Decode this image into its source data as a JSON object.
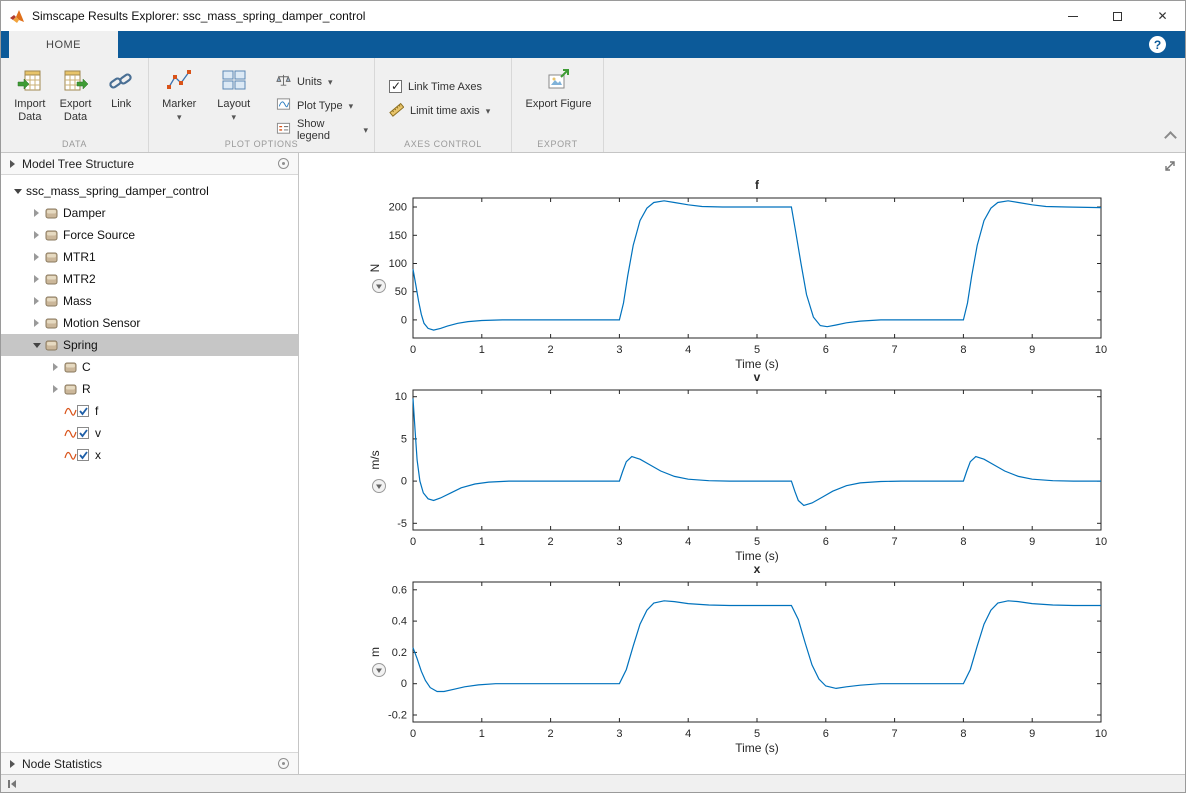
{
  "window": {
    "title": "Simscape Results Explorer: ssc_mass_spring_damper_control"
  },
  "ribbon": {
    "tab": "HOME",
    "sections": {
      "data": {
        "label": "DATA",
        "import": "Import Data",
        "export": "Export Data",
        "link": "Link"
      },
      "plot_options": {
        "label": "PLOT OPTIONS",
        "marker": "Marker",
        "layout": "Layout",
        "units": "Units",
        "plot_type": "Plot Type",
        "show_legend": "Show legend"
      },
      "axes_control": {
        "label": "AXES CONTROL",
        "link_time_axes": "Link Time Axes",
        "link_checked": true,
        "limit_time_axis": "Limit time axis",
        "limit_checked": false
      },
      "export": {
        "label": "EXPORT",
        "export_figure": "Export Figure"
      }
    }
  },
  "left_panel": {
    "tree_header": "Model Tree Structure",
    "stats_header": "Node Statistics",
    "tree": [
      {
        "label": "ssc_mass_spring_damper_control",
        "level": 0,
        "expander": "expanded",
        "icon": "none",
        "selected": false
      },
      {
        "label": "Damper",
        "level": 1,
        "expander": "collapsed",
        "icon": "component",
        "selected": false
      },
      {
        "label": "Force Source",
        "level": 1,
        "expander": "collapsed",
        "icon": "component",
        "selected": false
      },
      {
        "label": "MTR1",
        "level": 1,
        "expander": "collapsed",
        "icon": "component",
        "selected": false
      },
      {
        "label": "MTR2",
        "level": 1,
        "expander": "collapsed",
        "icon": "component",
        "selected": false
      },
      {
        "label": "Mass",
        "level": 1,
        "expander": "collapsed",
        "icon": "component",
        "selected": false
      },
      {
        "label": "Motion Sensor",
        "level": 1,
        "expander": "collapsed",
        "icon": "component",
        "selected": false
      },
      {
        "label": "Spring",
        "level": 1,
        "expander": "expanded",
        "icon": "component",
        "selected": true
      },
      {
        "label": "C",
        "level": 2,
        "expander": "collapsed",
        "icon": "component",
        "selected": false
      },
      {
        "label": "R",
        "level": 2,
        "expander": "collapsed",
        "icon": "component",
        "selected": false
      },
      {
        "label": "f",
        "level": 2,
        "expander": "none",
        "icon": "signal",
        "selected": false
      },
      {
        "label": "v",
        "level": 2,
        "expander": "none",
        "icon": "signal",
        "selected": false
      },
      {
        "label": "x",
        "level": 2,
        "expander": "none",
        "icon": "signal",
        "selected": false
      }
    ]
  },
  "chart_data": [
    {
      "type": "line",
      "title": "f",
      "xlabel": "Time (s)",
      "ylabel": "N",
      "xlim": [
        0,
        10
      ],
      "ylim": [
        -32,
        216
      ],
      "xticks": [
        0,
        1,
        2,
        3,
        4,
        5,
        6,
        7,
        8,
        9,
        10
      ],
      "yticks": [
        0,
        50,
        100,
        150,
        200
      ],
      "grid": false,
      "legend": false,
      "line_color": "#0072bd",
      "axis_color": "#262626",
      "series": [
        {
          "name": "f",
          "points": [
            [
              0,
              90
            ],
            [
              0.04,
              62
            ],
            [
              0.08,
              34
            ],
            [
              0.12,
              10
            ],
            [
              0.16,
              -6
            ],
            [
              0.22,
              -15
            ],
            [
              0.3,
              -18
            ],
            [
              0.4,
              -15
            ],
            [
              0.5,
              -11
            ],
            [
              0.65,
              -6
            ],
            [
              0.8,
              -3
            ],
            [
              1.0,
              -1
            ],
            [
              1.3,
              0
            ],
            [
              3.0,
              0
            ],
            [
              3.06,
              30
            ],
            [
              3.12,
              78
            ],
            [
              3.2,
              132
            ],
            [
              3.3,
              176
            ],
            [
              3.4,
              198
            ],
            [
              3.5,
              208
            ],
            [
              3.65,
              211
            ],
            [
              3.8,
              208
            ],
            [
              4.0,
              204
            ],
            [
              4.2,
              201
            ],
            [
              4.5,
              200
            ],
            [
              5.5,
              200
            ],
            [
              5.56,
              158
            ],
            [
              5.64,
              100
            ],
            [
              5.72,
              45
            ],
            [
              5.82,
              5
            ],
            [
              5.92,
              -10
            ],
            [
              6.02,
              -12
            ],
            [
              6.15,
              -9
            ],
            [
              6.3,
              -5
            ],
            [
              6.5,
              -2
            ],
            [
              6.8,
              0
            ],
            [
              8.0,
              0
            ],
            [
              8.06,
              30
            ],
            [
              8.12,
              78
            ],
            [
              8.2,
              132
            ],
            [
              8.3,
              176
            ],
            [
              8.4,
              198
            ],
            [
              8.5,
              208
            ],
            [
              8.65,
              211
            ],
            [
              8.8,
              208
            ],
            [
              9.0,
              204
            ],
            [
              9.2,
              201
            ],
            [
              9.5,
              200
            ],
            [
              10,
              199
            ]
          ]
        }
      ]
    },
    {
      "type": "line",
      "title": "v",
      "xlabel": "Time (s)",
      "ylabel": "m/s",
      "xlim": [
        0,
        10
      ],
      "ylim": [
        -5.8,
        10.8
      ],
      "xticks": [
        0,
        1,
        2,
        3,
        4,
        5,
        6,
        7,
        8,
        9,
        10
      ],
      "yticks": [
        -5,
        0,
        5,
        10
      ],
      "grid": false,
      "legend": false,
      "line_color": "#0072bd",
      "axis_color": "#262626",
      "series": [
        {
          "name": "v",
          "points": [
            [
              0,
              9.8
            ],
            [
              0.03,
              6.0
            ],
            [
              0.06,
              2.5
            ],
            [
              0.1,
              0
            ],
            [
              0.15,
              -1.4
            ],
            [
              0.22,
              -2.1
            ],
            [
              0.3,
              -2.3
            ],
            [
              0.4,
              -2.0
            ],
            [
              0.55,
              -1.4
            ],
            [
              0.7,
              -0.8
            ],
            [
              0.9,
              -0.35
            ],
            [
              1.1,
              -0.12
            ],
            [
              1.4,
              0
            ],
            [
              3.0,
              0
            ],
            [
              3.05,
              1.2
            ],
            [
              3.1,
              2.3
            ],
            [
              3.18,
              2.9
            ],
            [
              3.3,
              2.6
            ],
            [
              3.45,
              1.9
            ],
            [
              3.6,
              1.2
            ],
            [
              3.8,
              0.55
            ],
            [
              4.0,
              0.22
            ],
            [
              4.3,
              0.05
            ],
            [
              4.6,
              0
            ],
            [
              5.5,
              0
            ],
            [
              5.55,
              -1.2
            ],
            [
              5.6,
              -2.3
            ],
            [
              5.68,
              -2.9
            ],
            [
              5.8,
              -2.6
            ],
            [
              5.95,
              -1.9
            ],
            [
              6.1,
              -1.2
            ],
            [
              6.3,
              -0.55
            ],
            [
              6.5,
              -0.22
            ],
            [
              6.8,
              -0.05
            ],
            [
              7.1,
              0
            ],
            [
              8.0,
              0
            ],
            [
              8.05,
              1.2
            ],
            [
              8.1,
              2.3
            ],
            [
              8.18,
              2.9
            ],
            [
              8.3,
              2.6
            ],
            [
              8.45,
              1.9
            ],
            [
              8.6,
              1.2
            ],
            [
              8.8,
              0.55
            ],
            [
              9.0,
              0.22
            ],
            [
              9.3,
              0.05
            ],
            [
              9.6,
              0
            ],
            [
              10,
              0
            ]
          ]
        }
      ]
    },
    {
      "type": "line",
      "title": "x",
      "xlabel": "Time (s)",
      "ylabel": "m",
      "xlim": [
        0,
        10
      ],
      "ylim": [
        -0.245,
        0.65
      ],
      "xticks": [
        0,
        1,
        2,
        3,
        4,
        5,
        6,
        7,
        8,
        9,
        10
      ],
      "yticks": [
        -0.2,
        0,
        0.2,
        0.4,
        0.6
      ],
      "grid": false,
      "legend": false,
      "line_color": "#0072bd",
      "axis_color": "#262626",
      "series": [
        {
          "name": "x",
          "points": [
            [
              0,
              0.23
            ],
            [
              0.06,
              0.16
            ],
            [
              0.12,
              0.08
            ],
            [
              0.18,
              0.02
            ],
            [
              0.25,
              -0.025
            ],
            [
              0.35,
              -0.05
            ],
            [
              0.45,
              -0.05
            ],
            [
              0.6,
              -0.035
            ],
            [
              0.75,
              -0.02
            ],
            [
              0.95,
              -0.008
            ],
            [
              1.2,
              0
            ],
            [
              3.0,
              0
            ],
            [
              3.1,
              0.09
            ],
            [
              3.2,
              0.24
            ],
            [
              3.3,
              0.38
            ],
            [
              3.4,
              0.47
            ],
            [
              3.5,
              0.515
            ],
            [
              3.65,
              0.53
            ],
            [
              3.8,
              0.525
            ],
            [
              4.0,
              0.512
            ],
            [
              4.3,
              0.503
            ],
            [
              4.6,
              0.5
            ],
            [
              5.5,
              0.5
            ],
            [
              5.6,
              0.41
            ],
            [
              5.7,
              0.26
            ],
            [
              5.8,
              0.12
            ],
            [
              5.9,
              0.03
            ],
            [
              6.0,
              -0.015
            ],
            [
              6.15,
              -0.03
            ],
            [
              6.3,
              -0.02
            ],
            [
              6.5,
              -0.01
            ],
            [
              6.8,
              0
            ],
            [
              8.0,
              0
            ],
            [
              8.1,
              0.09
            ],
            [
              8.2,
              0.24
            ],
            [
              8.3,
              0.38
            ],
            [
              8.4,
              0.47
            ],
            [
              8.5,
              0.515
            ],
            [
              8.65,
              0.53
            ],
            [
              8.8,
              0.525
            ],
            [
              9.0,
              0.512
            ],
            [
              9.3,
              0.503
            ],
            [
              9.6,
              0.5
            ],
            [
              10,
              0.5
            ]
          ]
        }
      ]
    }
  ]
}
